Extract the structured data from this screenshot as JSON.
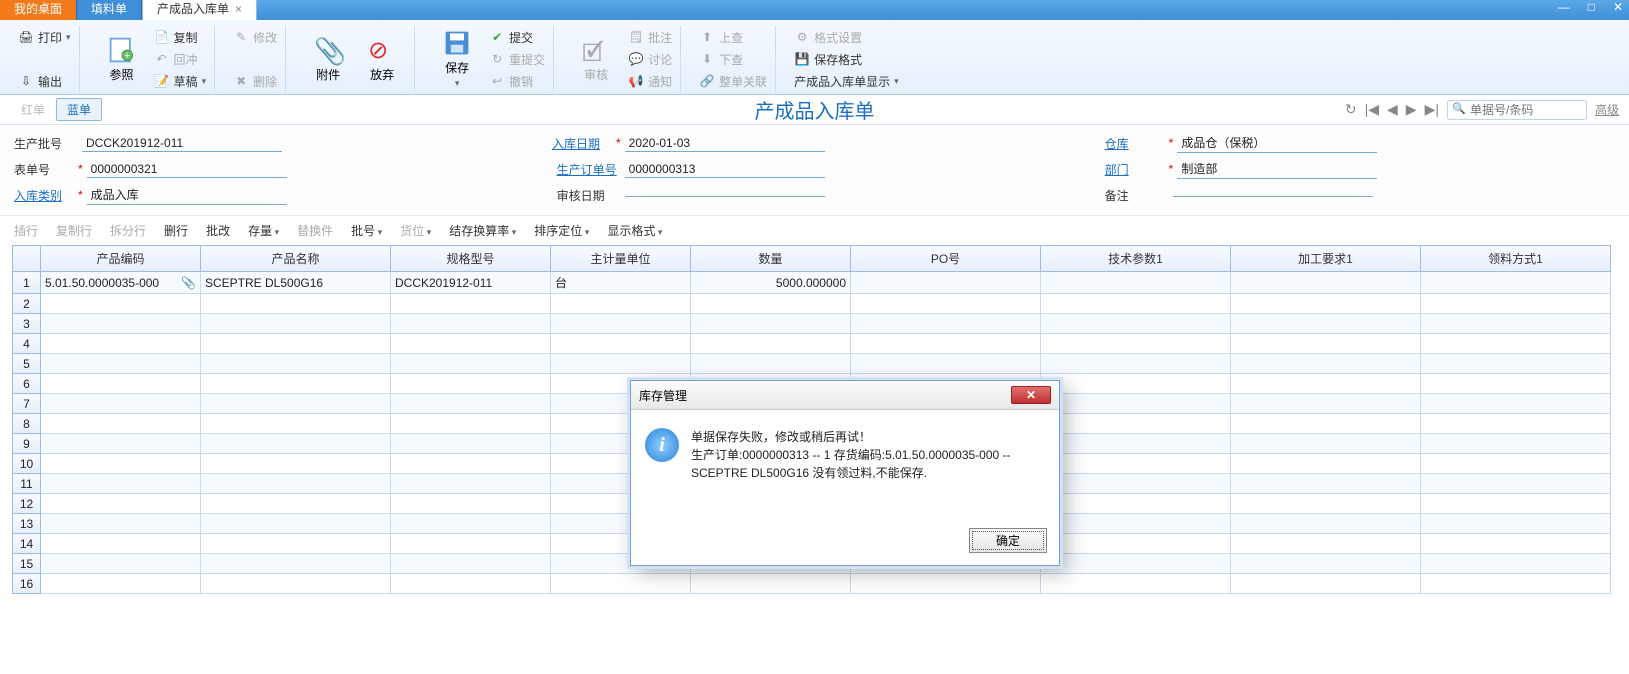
{
  "tabs": {
    "t0": "我的桌面",
    "t1": "填料单",
    "t2": "产成品入库单"
  },
  "win": {
    "min": "—",
    "max": "□",
    "close": "✕"
  },
  "ribbon": {
    "print": "打印",
    "export": "输出",
    "ref": "参照",
    "copy": "复制",
    "rollback": "回冲",
    "draft": "草稿",
    "edit": "修改",
    "del": "删除",
    "attach": "附件",
    "abandon": "放弃",
    "save": "保存",
    "submit": "提交",
    "resubmit": "重提交",
    "revoke": "撤销",
    "audit": "审核",
    "batchAudit": "批注",
    "discuss": "讨论",
    "notify": "通知",
    "up": "上查",
    "down": "下查",
    "whole": "整单关联",
    "fmt": "格式设置",
    "saveFmt": "保存格式",
    "show": "产成品入库单显示"
  },
  "subbar": {
    "red": "红单",
    "blue": "蓝单",
    "title": "产成品入库单",
    "searchPh": "单据号/条码",
    "adv": "高级"
  },
  "form": {
    "l_batch": "生产批号",
    "v_batch": "DCCK201912-011",
    "l_date": "入库日期",
    "v_date": "2020-01-03",
    "l_wh": "仓库",
    "v_wh": "成品仓（保税）",
    "l_doc": "表单号",
    "v_doc": "0000000321",
    "l_order": "生产订单号",
    "v_order": "0000000313",
    "l_dept": "部门",
    "v_dept": "制造部",
    "l_type": "入库类别",
    "v_type": "成品入库",
    "l_audit": "审核日期",
    "v_audit": "",
    "l_remark": "备注",
    "v_remark": ""
  },
  "gt": {
    "ins": "插行",
    "cpy": "复制行",
    "split": "拆分行",
    "del": "删行",
    "batch": "批改",
    "stock": "存量",
    "repl": "替换件",
    "lot": "批号",
    "loc": "货位",
    "rate": "结存换算率",
    "sort": "排序定位",
    "disp": "显示格式"
  },
  "cols": [
    "产品编码",
    "产品名称",
    "规格型号",
    "主计量单位",
    "数量",
    "PO号",
    "技术参数1",
    "加工要求1",
    "领料方式1"
  ],
  "row1": {
    "code": "5.01.50.0000035-000",
    "name": "SCEPTRE DL500G16",
    "spec": "DCCK201912-011",
    "unit": "台",
    "qty": "5000.000000"
  },
  "dialog": {
    "title": "库存管理",
    "line1": "单据保存失败，修改或稍后再试！",
    "line2": "生产订单:0000000313 -- 1 存货编码:5.01.50.0000035-000 -- SCEPTRE DL500G16 没有领过料,不能保存.",
    "ok": "确定"
  }
}
